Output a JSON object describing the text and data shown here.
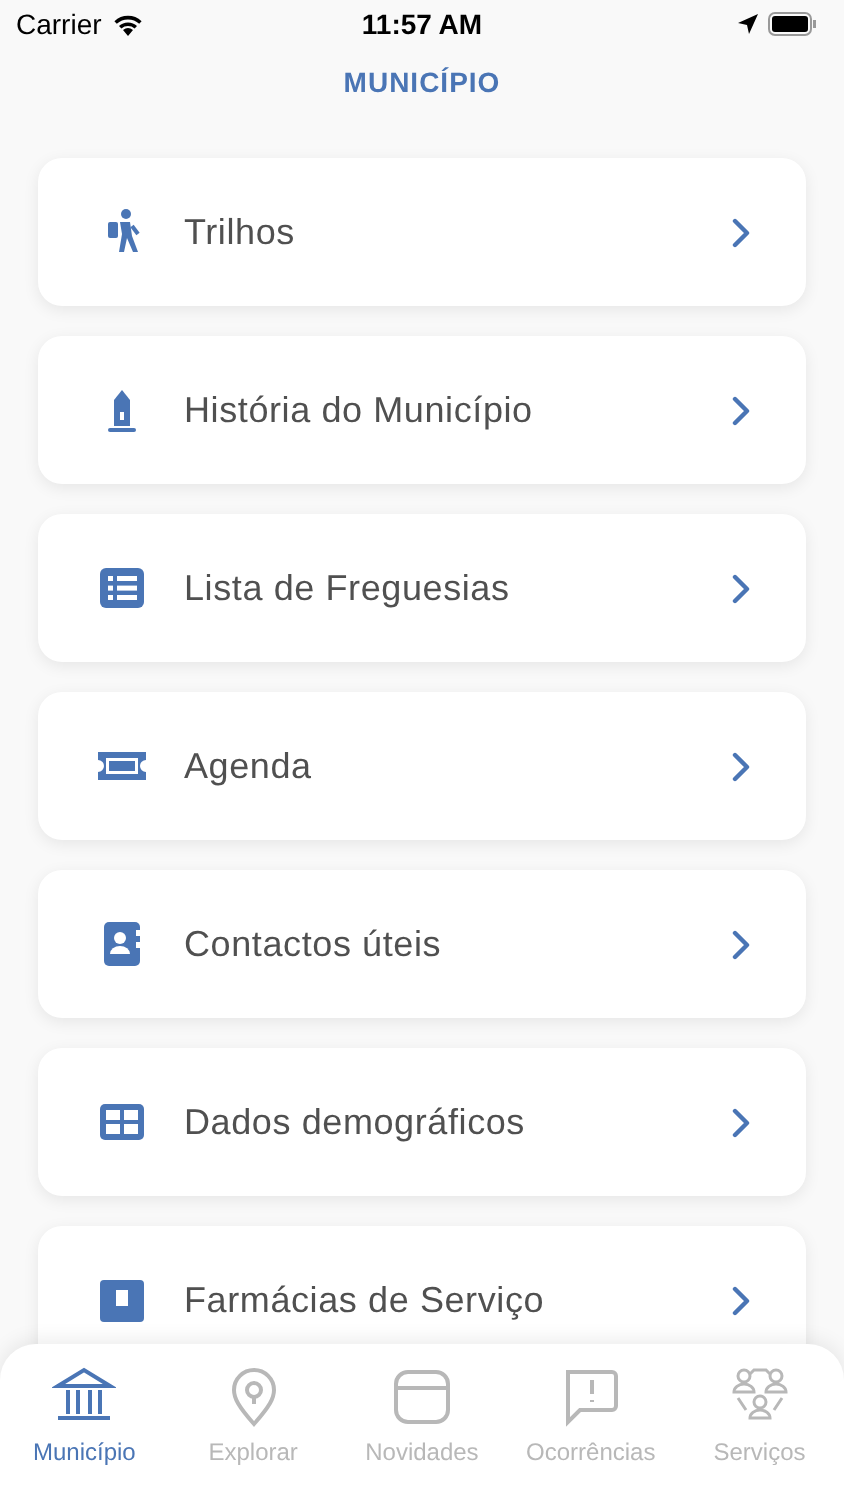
{
  "status_bar": {
    "carrier": "Carrier",
    "time": "11:57 AM"
  },
  "title": "MUNICÍPIO",
  "menu": [
    {
      "label": "Trilhos"
    },
    {
      "label": "História do Município"
    },
    {
      "label": "Lista de Freguesias"
    },
    {
      "label": "Agenda"
    },
    {
      "label": "Contactos úteis"
    },
    {
      "label": "Dados demográficos"
    },
    {
      "label": "Farmácias de Serviço"
    }
  ],
  "tabs": [
    {
      "label": "Município",
      "selected": true
    },
    {
      "label": "Explorar",
      "selected": false
    },
    {
      "label": "Novidades",
      "selected": false
    },
    {
      "label": "Ocorrências",
      "selected": false
    },
    {
      "label": "Serviços",
      "selected": false
    }
  ]
}
